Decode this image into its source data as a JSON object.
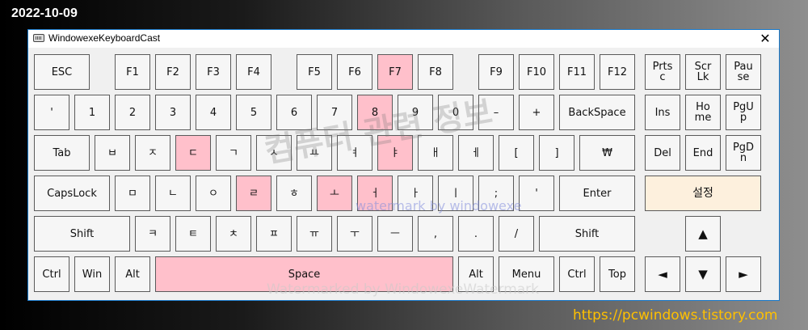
{
  "date_label": "2022-10-09",
  "window": {
    "title": "WindowexeKeyboardCast",
    "close_glyph": "✕",
    "app_icon": "keyboard-icon"
  },
  "keyboard": {
    "highlight_color": "#ffc0cb",
    "setting_color": "#fdf0dd",
    "keys": [
      {
        "id": "esc",
        "label": "ESC",
        "pressed": false
      },
      {
        "id": "f1",
        "label": "F1",
        "pressed": false
      },
      {
        "id": "f2",
        "label": "F2",
        "pressed": false
      },
      {
        "id": "f3",
        "label": "F3",
        "pressed": false
      },
      {
        "id": "f4",
        "label": "F4",
        "pressed": false
      },
      {
        "id": "f5",
        "label": "F5",
        "pressed": false
      },
      {
        "id": "f6",
        "label": "F6",
        "pressed": false
      },
      {
        "id": "f7",
        "label": "F7",
        "pressed": true
      },
      {
        "id": "f8",
        "label": "F8",
        "pressed": false
      },
      {
        "id": "f9",
        "label": "F9",
        "pressed": false
      },
      {
        "id": "f10",
        "label": "F10",
        "pressed": false
      },
      {
        "id": "f11",
        "label": "F11",
        "pressed": false
      },
      {
        "id": "f12",
        "label": "F12",
        "pressed": false
      },
      {
        "id": "prtsc",
        "label": "Prts\nc",
        "pressed": false
      },
      {
        "id": "scrlk",
        "label": "Scr\nLk",
        "pressed": false
      },
      {
        "id": "pause",
        "label": "Pau\nse",
        "pressed": false
      },
      {
        "id": "quote-top",
        "label": "'",
        "pressed": false
      },
      {
        "id": "1",
        "label": "1",
        "pressed": false
      },
      {
        "id": "2",
        "label": "2",
        "pressed": false
      },
      {
        "id": "3",
        "label": "3",
        "pressed": false
      },
      {
        "id": "4",
        "label": "4",
        "pressed": false
      },
      {
        "id": "5",
        "label": "5",
        "pressed": false
      },
      {
        "id": "6",
        "label": "6",
        "pressed": false
      },
      {
        "id": "7",
        "label": "7",
        "pressed": false
      },
      {
        "id": "8",
        "label": "8",
        "pressed": true
      },
      {
        "id": "9",
        "label": "9",
        "pressed": false
      },
      {
        "id": "0",
        "label": "0",
        "pressed": false
      },
      {
        "id": "minus",
        "label": "–",
        "pressed": false
      },
      {
        "id": "plus",
        "label": "+",
        "pressed": false
      },
      {
        "id": "backspace",
        "label": "BackSpace",
        "pressed": false
      },
      {
        "id": "ins",
        "label": "Ins",
        "pressed": false
      },
      {
        "id": "home",
        "label": "Ho\nme",
        "pressed": false
      },
      {
        "id": "pgup",
        "label": "PgU\np",
        "pressed": false
      },
      {
        "id": "tab",
        "label": "Tab",
        "pressed": false
      },
      {
        "id": "q",
        "label": "ㅂ",
        "pressed": false
      },
      {
        "id": "w",
        "label": "ㅈ",
        "pressed": false
      },
      {
        "id": "e",
        "label": "ㄷ",
        "pressed": true
      },
      {
        "id": "r",
        "label": "ㄱ",
        "pressed": false
      },
      {
        "id": "t",
        "label": "ㅅ",
        "pressed": false
      },
      {
        "id": "y",
        "label": "ㅛ",
        "pressed": false
      },
      {
        "id": "u",
        "label": "ㅕ",
        "pressed": false
      },
      {
        "id": "i",
        "label": "ㅑ",
        "pressed": true
      },
      {
        "id": "o",
        "label": "ㅐ",
        "pressed": false
      },
      {
        "id": "p",
        "label": "ㅔ",
        "pressed": false
      },
      {
        "id": "lbracket",
        "label": "[",
        "pressed": false
      },
      {
        "id": "rbracket",
        "label": "]",
        "pressed": false
      },
      {
        "id": "won",
        "label": "₩",
        "pressed": false
      },
      {
        "id": "del",
        "label": "Del",
        "pressed": false
      },
      {
        "id": "end",
        "label": "End",
        "pressed": false
      },
      {
        "id": "pgdn",
        "label": "PgD\nn",
        "pressed": false
      },
      {
        "id": "capslock",
        "label": "CapsLock",
        "pressed": false
      },
      {
        "id": "a",
        "label": "ㅁ",
        "pressed": false
      },
      {
        "id": "s",
        "label": "ㄴ",
        "pressed": false
      },
      {
        "id": "d",
        "label": "ㅇ",
        "pressed": false
      },
      {
        "id": "f",
        "label": "ㄹ",
        "pressed": true
      },
      {
        "id": "g",
        "label": "ㅎ",
        "pressed": false
      },
      {
        "id": "h",
        "label": "ㅗ",
        "pressed": true
      },
      {
        "id": "j",
        "label": "ㅓ",
        "pressed": true
      },
      {
        "id": "k",
        "label": "ㅏ",
        "pressed": false
      },
      {
        "id": "l",
        "label": "ㅣ",
        "pressed": false
      },
      {
        "id": "semicolon",
        "label": ";",
        "pressed": false
      },
      {
        "id": "apostrophe",
        "label": "'",
        "pressed": false
      },
      {
        "id": "enter",
        "label": "Enter",
        "pressed": false
      },
      {
        "id": "settings",
        "label": "설정",
        "pressed": false
      },
      {
        "id": "lshift",
        "label": "Shift",
        "pressed": false
      },
      {
        "id": "z",
        "label": "ㅋ",
        "pressed": false
      },
      {
        "id": "x",
        "label": "ㅌ",
        "pressed": false
      },
      {
        "id": "c",
        "label": "ㅊ",
        "pressed": false
      },
      {
        "id": "v",
        "label": "ㅍ",
        "pressed": false
      },
      {
        "id": "b",
        "label": "ㅠ",
        "pressed": false
      },
      {
        "id": "n",
        "label": "ㅜ",
        "pressed": false
      },
      {
        "id": "m",
        "label": "ㅡ",
        "pressed": false
      },
      {
        "id": "comma",
        "label": ",",
        "pressed": false
      },
      {
        "id": "period",
        "label": ".",
        "pressed": false
      },
      {
        "id": "slash",
        "label": "/",
        "pressed": false
      },
      {
        "id": "rshift",
        "label": "Shift",
        "pressed": false
      },
      {
        "id": "up",
        "label": "▲",
        "pressed": false
      },
      {
        "id": "lctrl",
        "label": "Ctrl",
        "pressed": false
      },
      {
        "id": "win",
        "label": "Win",
        "pressed": false
      },
      {
        "id": "lalt",
        "label": "Alt",
        "pressed": false
      },
      {
        "id": "space",
        "label": "Space",
        "pressed": true
      },
      {
        "id": "ralt",
        "label": "Alt",
        "pressed": false
      },
      {
        "id": "menu",
        "label": "Menu",
        "pressed": false
      },
      {
        "id": "rctrl",
        "label": "Ctrl",
        "pressed": false
      },
      {
        "id": "top",
        "label": "Top",
        "pressed": false
      },
      {
        "id": "left",
        "label": "◄",
        "pressed": false
      },
      {
        "id": "down",
        "label": "▼",
        "pressed": false
      },
      {
        "id": "right",
        "label": "►",
        "pressed": false
      }
    ]
  },
  "watermarks": {
    "korean": "컴퓨터 관련 정보",
    "blue": "watermark by windowexe",
    "bottom": "Watermarked by WindowexeWatermark"
  },
  "footer_url": "https://pcwindows.tistory.com"
}
